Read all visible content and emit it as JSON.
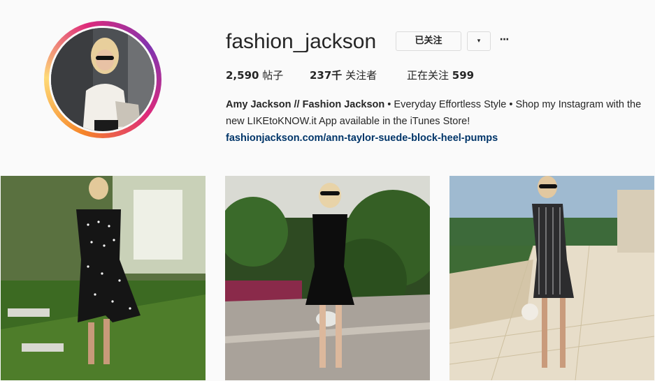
{
  "profile": {
    "username": "fashion_jackson",
    "follow_label": "已关注",
    "dropdown_icon": "▾",
    "more_icon": "···",
    "avatar_icon": "profile-photo"
  },
  "stats": {
    "posts_count": "2,590",
    "posts_label": " 帖子",
    "followers_count": "237千",
    "followers_label": " 关注者",
    "following_label": "正在关注 ",
    "following_count": "599"
  },
  "bio": {
    "name": "Amy Jackson // Fashion Jackson",
    "text": " • Everyday Effortless Style • Shop my Instagram with the new LIKEtoKNOW.it App available in the iTunes Store!",
    "link": "fashionjackson.com/ann-taylor-suede-block-heel-pumps"
  },
  "posts": [
    {
      "id": "post-1",
      "description_icon": "photo-polka-dot-dress"
    },
    {
      "id": "post-2",
      "description_icon": "photo-black-dress"
    },
    {
      "id": "post-3",
      "description_icon": "photo-striped-dress"
    }
  ],
  "colors": {
    "link": "#003569",
    "text": "#262626",
    "background": "#fafafa",
    "border": "#dbdbdb"
  }
}
